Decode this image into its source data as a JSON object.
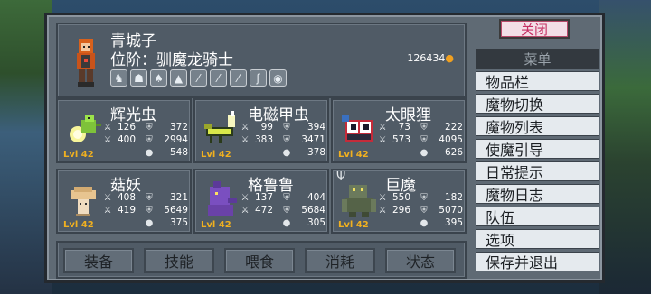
{
  "hero": {
    "name": "青城子",
    "rank": "位阶：驯魔龙骑士",
    "gold": "126434",
    "gold_icon": "coin-icon",
    "badges": [
      "winged-boot-icon",
      "monster-badge-icon",
      "horn-badge-icon",
      "tooth-badge-icon",
      "feather-badge-icon",
      "feather-badge-icon",
      "feather-badge-icon",
      "claw-badge-icon",
      "chest-badge-icon"
    ]
  },
  "monsters": [
    {
      "name": "辉光虫",
      "level": "Lvl 42",
      "atk": "126",
      "def": "372",
      "matk": "400",
      "mdef": "2994",
      "wt": "548",
      "sprite": "glowbug-sprite",
      "accent": "#9be34a"
    },
    {
      "name": "电磁甲虫",
      "level": "Lvl 42",
      "atk": "99",
      "def": "394",
      "matk": "383",
      "mdef": "3471",
      "wt": "378",
      "sprite": "beetle-sprite",
      "accent": "#d8e84a"
    },
    {
      "name": "太眼狸",
      "level": "Lvl 42",
      "atk": "73",
      "def": "222",
      "matk": "573",
      "mdef": "4095",
      "wt": "626",
      "sprite": "raccoon-sprite",
      "accent": "#d8334a"
    },
    {
      "name": "菇妖",
      "level": "Lvl 42",
      "atk": "408",
      "def": "321",
      "matk": "419",
      "mdef": "5649",
      "wt": "375",
      "sprite": "mushroom-sprite",
      "accent": "#e7c490"
    },
    {
      "name": "格鲁鲁",
      "level": "Lvl 42",
      "atk": "137",
      "def": "404",
      "matk": "472",
      "mdef": "5684",
      "wt": "305",
      "sprite": "gruru-sprite",
      "accent": "#7a4fc0"
    },
    {
      "name": "巨魔",
      "level": "Lvl 42",
      "atk": "550",
      "def": "182",
      "matk": "296",
      "mdef": "5070",
      "wt": "395",
      "sprite": "troll-sprite",
      "accent": "#6b7a5c"
    }
  ],
  "actions": [
    "装备",
    "技能",
    "喂食",
    "消耗",
    "状态"
  ],
  "menu": {
    "close": "关闭",
    "title": "菜单",
    "items": [
      "物品栏",
      "魔物切换",
      "魔物列表",
      "使魔引导",
      "日常提示",
      "魔物日志",
      "队伍",
      "选项",
      "保存并退出"
    ]
  },
  "colors": {
    "level": "#f0b020",
    "close_text": "#c52f63",
    "panel": "#5f6a74"
  }
}
